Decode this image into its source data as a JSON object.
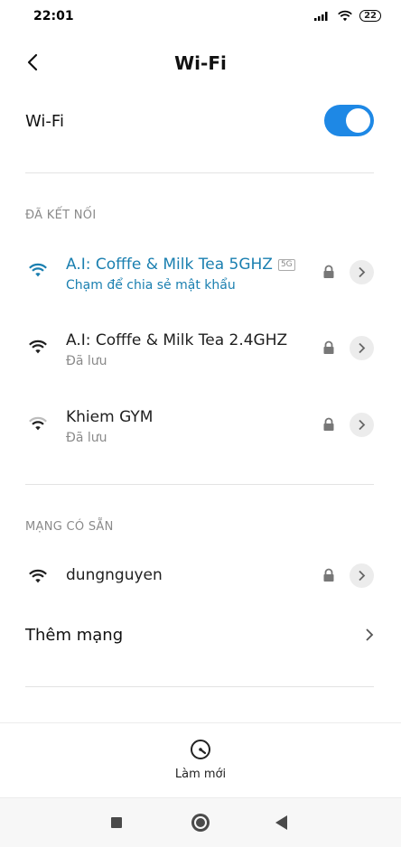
{
  "status_bar": {
    "time": "22:01",
    "battery": "22"
  },
  "header": {
    "title": "Wi-Fi"
  },
  "wifi_toggle": {
    "label": "Wi-Fi",
    "enabled": true
  },
  "sections": {
    "connected_title": "ĐÃ KẾT NỐI",
    "available_title": "MẠNG CÓ SẴN"
  },
  "connected_networks": [
    {
      "name": "A.I: Cofffe & Milk Tea 5GHZ",
      "band_tag": "5G",
      "subtitle": "Chạm để chia sẻ mật khẩu",
      "active": true,
      "locked": true
    },
    {
      "name": "A.I: Cofffe & Milk Tea 2.4GHZ",
      "subtitle": "Đã lưu",
      "active": false,
      "locked": true
    },
    {
      "name": "Khiem GYM",
      "subtitle": "Đã lưu",
      "active": false,
      "locked": true
    }
  ],
  "available_networks": [
    {
      "name": "dungnguyen",
      "locked": true
    }
  ],
  "add_network": {
    "label": "Thêm mạng"
  },
  "refresh": {
    "label": "Làm mới"
  },
  "colors": {
    "accent": "#1e88e5",
    "active_text": "#1a7fb0",
    "section_text": "#8a8a8a"
  }
}
